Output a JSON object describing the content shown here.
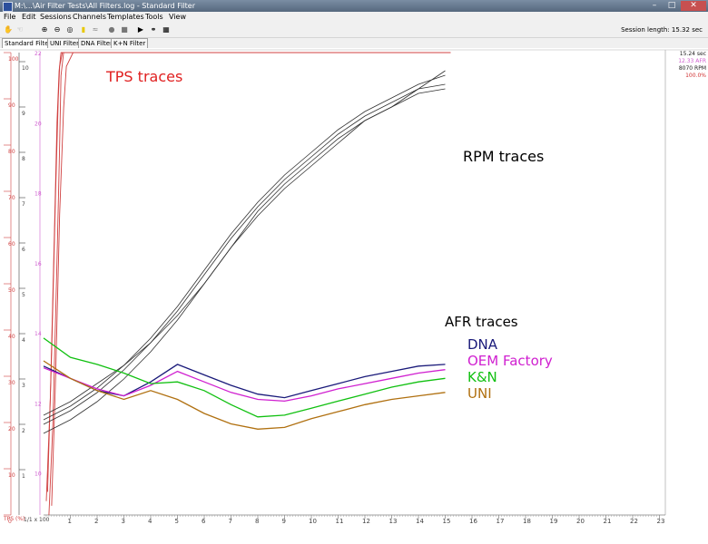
{
  "window": {
    "title": "M:\\...\\Air Filter Tests\\All Filters.log - Standard Filter",
    "minimize_icon": "minimize-icon",
    "maximize_icon": "maximize-icon",
    "close_icon": "close-icon"
  },
  "menu": {
    "items": [
      {
        "label": "File",
        "key": "file"
      },
      {
        "label": "Edit",
        "key": "edit"
      },
      {
        "label": "Sessions",
        "key": "sessions"
      },
      {
        "label": "Channels",
        "key": "channels"
      },
      {
        "label": "Templates",
        "key": "templates"
      },
      {
        "label": "Tools",
        "key": "tools"
      },
      {
        "label": "View",
        "key": "view"
      }
    ]
  },
  "toolbar": {
    "tools": [
      {
        "icon": "hand-icon",
        "glyph": "✋"
      },
      {
        "icon": "hand-alt-icon",
        "glyph": "☜"
      },
      {
        "icon": "zoom-in-icon",
        "glyph": "⊕"
      },
      {
        "icon": "zoom-out-icon",
        "glyph": "⊖"
      },
      {
        "icon": "zoom-fit-icon",
        "glyph": "◎"
      },
      {
        "icon": "note-icon",
        "glyph": "▮"
      },
      {
        "icon": "wave-icon",
        "glyph": "≈"
      },
      {
        "icon": "record-icon",
        "glyph": "●"
      },
      {
        "icon": "stop-icon",
        "glyph": "■"
      },
      {
        "icon": "play-icon",
        "glyph": "▶"
      },
      {
        "icon": "binoculars-icon",
        "glyph": "⚭"
      },
      {
        "icon": "table-icon",
        "glyph": "▦"
      }
    ],
    "session_length": "Session length: 15.32 sec"
  },
  "tabs": [
    {
      "label": "Standard Filter",
      "active": true
    },
    {
      "label": "UNI Filter",
      "active": false
    },
    {
      "label": "DNA Filter",
      "active": false
    },
    {
      "label": "K+N Filter",
      "active": false
    }
  ],
  "readout": {
    "time": "15.24 sec",
    "afr": "12.33 AFR",
    "rpm": "8070 RPM",
    "tps": "100.0%",
    "colors": {
      "afr": "#d060d0",
      "tps": "#d03030",
      "rpm": "#202020",
      "time": "#202020"
    }
  },
  "chart_data": {
    "type": "line",
    "x_axis": {
      "ticks": [
        "1",
        "2",
        "3",
        "4",
        "5",
        "6",
        "7",
        "8",
        "9",
        "10",
        "11",
        "12",
        "13",
        "14",
        "15",
        "16",
        "17",
        "18",
        "19",
        "20",
        "21",
        "22",
        "23"
      ],
      "xlim": [
        0,
        23
      ],
      "origin_label": "TPS (%)",
      "origin_scale": "1/1 x 100"
    },
    "axes": {
      "tps": {
        "unit_label": "",
        "ticks": [
          "100",
          "90",
          "80",
          "70",
          "60",
          "50",
          "40",
          "30",
          "20",
          "10",
          "0"
        ],
        "ylim": [
          0,
          100
        ],
        "color": "#d04040"
      },
      "rpm": {
        "ticks": [
          "10",
          "9",
          "8",
          "7",
          "6",
          "5",
          "4",
          "3",
          "2",
          "1"
        ],
        "ylim": [
          0,
          10.2
        ],
        "color": "#404040"
      },
      "afr": {
        "ticks": [
          "22",
          "20",
          "18",
          "16",
          "14",
          "12",
          "10"
        ],
        "ylim": [
          8.8,
          22
        ],
        "color": "#d060d0"
      }
    },
    "annotations": [
      {
        "text": "TPS traces",
        "color": "#e02020"
      },
      {
        "text": "RPM traces",
        "color": "#000000"
      },
      {
        "text": "AFR traces",
        "color": "#000000"
      },
      {
        "text": "DNA",
        "color": "#1a1a7a"
      },
      {
        "text": "OEM Factory",
        "color": "#d020d0"
      },
      {
        "text": "K&N",
        "color": "#10c010"
      },
      {
        "text": "UNI",
        "color": "#b07010"
      }
    ],
    "tps_series": [
      {
        "name": "",
        "points": [
          [
            0.2,
            0
          ],
          [
            0.35,
            20
          ],
          [
            0.5,
            55
          ],
          [
            0.6,
            80
          ],
          [
            0.65,
            95
          ],
          [
            0.75,
            100
          ],
          [
            15.2,
            100
          ]
        ]
      },
      {
        "name": "",
        "points": [
          [
            0.15,
            5
          ],
          [
            0.3,
            35
          ],
          [
            0.45,
            70
          ],
          [
            0.55,
            90
          ],
          [
            0.6,
            97
          ],
          [
            0.7,
            100
          ],
          [
            15.2,
            100
          ]
        ]
      },
      {
        "name": "",
        "points": [
          [
            0.1,
            3
          ],
          [
            0.25,
            25
          ],
          [
            0.4,
            60
          ],
          [
            0.5,
            85
          ],
          [
            0.58,
            96
          ],
          [
            0.65,
            100
          ],
          [
            15.2,
            100
          ]
        ]
      },
      {
        "name": "",
        "points": [
          [
            0.3,
            2
          ],
          [
            0.45,
            30
          ],
          [
            0.6,
            65
          ],
          [
            0.75,
            88
          ],
          [
            0.85,
            97
          ],
          [
            1.1,
            100
          ],
          [
            15.2,
            100
          ]
        ]
      }
    ],
    "rpm_series": [
      {
        "name": "",
        "points": [
          [
            0,
            2.1
          ],
          [
            1,
            2.4
          ],
          [
            2,
            2.8
          ],
          [
            3,
            3.3
          ],
          [
            4,
            3.9
          ],
          [
            5,
            4.6
          ],
          [
            6,
            5.4
          ],
          [
            7,
            6.2
          ],
          [
            8,
            6.9
          ],
          [
            9,
            7.5
          ],
          [
            10,
            8.0
          ],
          [
            11,
            8.5
          ],
          [
            12,
            8.9
          ],
          [
            13,
            9.2
          ],
          [
            14,
            9.5
          ],
          [
            15,
            9.7
          ]
        ]
      },
      {
        "name": "",
        "points": [
          [
            0,
            2.0
          ],
          [
            1,
            2.3
          ],
          [
            2,
            2.7
          ],
          [
            3,
            3.2
          ],
          [
            4,
            3.8
          ],
          [
            5,
            4.5
          ],
          [
            6,
            5.3
          ],
          [
            7,
            6.1
          ],
          [
            8,
            6.8
          ],
          [
            9,
            7.4
          ],
          [
            10,
            7.9
          ],
          [
            11,
            8.4
          ],
          [
            12,
            8.8
          ],
          [
            13,
            9.1
          ],
          [
            14,
            9.4
          ],
          [
            15,
            9.5
          ]
        ]
      },
      {
        "name": "",
        "points": [
          [
            0,
            2.2
          ],
          [
            1,
            2.5
          ],
          [
            2,
            2.9
          ],
          [
            3,
            3.3
          ],
          [
            4,
            3.8
          ],
          [
            5,
            4.4
          ],
          [
            6,
            5.1
          ],
          [
            7,
            5.9
          ],
          [
            8,
            6.7
          ],
          [
            9,
            7.3
          ],
          [
            10,
            7.8
          ],
          [
            11,
            8.3
          ],
          [
            12,
            8.7
          ],
          [
            13,
            9.0
          ],
          [
            14,
            9.3
          ],
          [
            15,
            9.4
          ]
        ]
      },
      {
        "name": "",
        "points": [
          [
            0,
            1.8
          ],
          [
            1,
            2.1
          ],
          [
            2,
            2.5
          ],
          [
            3,
            3.0
          ],
          [
            4,
            3.6
          ],
          [
            5,
            4.3
          ],
          [
            6,
            5.1
          ],
          [
            7,
            5.9
          ],
          [
            8,
            6.6
          ],
          [
            9,
            7.2
          ],
          [
            10,
            7.7
          ],
          [
            11,
            8.2
          ],
          [
            12,
            8.7
          ],
          [
            13,
            9.0
          ],
          [
            14,
            9.4
          ],
          [
            15,
            9.8
          ]
        ]
      }
    ],
    "afr_series": [
      {
        "name": "DNA",
        "color": "#1a1a7a",
        "points": [
          [
            0,
            13.05
          ],
          [
            1,
            12.7
          ],
          [
            2,
            12.35
          ],
          [
            3,
            12.2
          ],
          [
            4,
            12.6
          ],
          [
            5,
            13.1
          ],
          [
            6,
            12.8
          ],
          [
            7,
            12.5
          ],
          [
            8,
            12.25
          ],
          [
            9,
            12.15
          ],
          [
            10,
            12.35
          ],
          [
            11,
            12.55
          ],
          [
            12,
            12.75
          ],
          [
            13,
            12.9
          ],
          [
            14,
            13.05
          ],
          [
            15,
            13.1
          ]
        ]
      },
      {
        "name": "OEM Factory",
        "color": "#d020d0",
        "points": [
          [
            0,
            13.0
          ],
          [
            1,
            12.7
          ],
          [
            2,
            12.4
          ],
          [
            3,
            12.2
          ],
          [
            4,
            12.5
          ],
          [
            5,
            12.9
          ],
          [
            6,
            12.6
          ],
          [
            7,
            12.3
          ],
          [
            8,
            12.1
          ],
          [
            9,
            12.05
          ],
          [
            10,
            12.2
          ],
          [
            11,
            12.4
          ],
          [
            12,
            12.55
          ],
          [
            13,
            12.7
          ],
          [
            14,
            12.85
          ],
          [
            15,
            12.95
          ]
        ]
      },
      {
        "name": "K&N",
        "color": "#10c010",
        "points": [
          [
            0,
            13.85
          ],
          [
            1,
            13.3
          ],
          [
            2,
            13.1
          ],
          [
            3,
            12.85
          ],
          [
            4,
            12.55
          ],
          [
            5,
            12.6
          ],
          [
            6,
            12.35
          ],
          [
            7,
            11.95
          ],
          [
            8,
            11.6
          ],
          [
            9,
            11.65
          ],
          [
            10,
            11.85
          ],
          [
            11,
            12.05
          ],
          [
            12,
            12.25
          ],
          [
            13,
            12.45
          ],
          [
            14,
            12.6
          ],
          [
            15,
            12.7
          ]
        ]
      },
      {
        "name": "UNI",
        "color": "#b07010",
        "points": [
          [
            0,
            13.2
          ],
          [
            1,
            12.7
          ],
          [
            2,
            12.35
          ],
          [
            3,
            12.1
          ],
          [
            4,
            12.35
          ],
          [
            5,
            12.1
          ],
          [
            6,
            11.7
          ],
          [
            7,
            11.4
          ],
          [
            8,
            11.25
          ],
          [
            9,
            11.3
          ],
          [
            10,
            11.55
          ],
          [
            11,
            11.75
          ],
          [
            12,
            11.95
          ],
          [
            13,
            12.1
          ],
          [
            14,
            12.2
          ],
          [
            15,
            12.3
          ]
        ]
      }
    ]
  }
}
